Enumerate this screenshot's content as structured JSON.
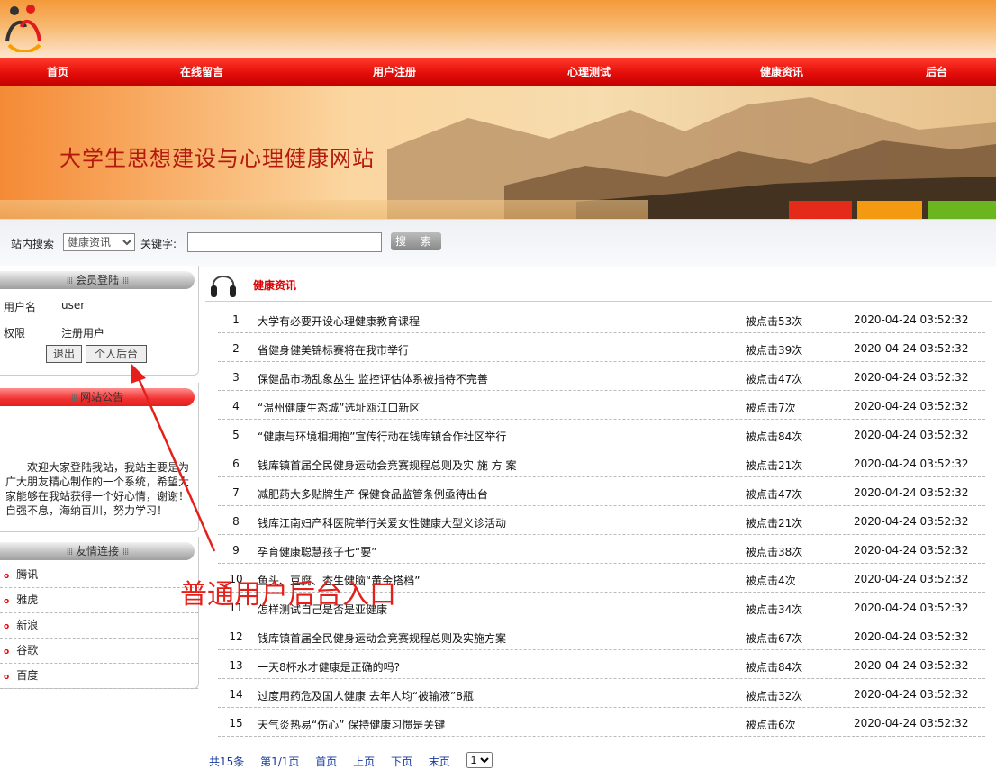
{
  "nav": [
    "首页",
    "在线留言",
    "用户注册",
    "心理测试",
    "健康资讯",
    "后台"
  ],
  "banner": {
    "title": "大学生思想建设与心理健康网站"
  },
  "search": {
    "site_label": "站内搜索",
    "selected": "健康资讯",
    "keyword_label": "关键字:",
    "keyword_value": "",
    "button": "搜 索"
  },
  "login": {
    "title": "会员登陆",
    "user_label": "用户名",
    "user_value": "user",
    "role_label": "权限",
    "role_value": "注册用户",
    "logout": "退出",
    "admin": "个人后台"
  },
  "notice": {
    "title": "网站公告",
    "text": "欢迎大家登陆我站，我站主要是为广大朋友精心制作的一个系统，希望大家能够在我站获得一个好心情，谢谢！ 自强不息，海纳百川，努力学习！"
  },
  "links": {
    "title": "友情连接",
    "items": [
      "腾讯",
      "雅虎",
      "新浪",
      "谷歌",
      "百度"
    ]
  },
  "main": {
    "category": "健康资讯",
    "articles": [
      {
        "n": "1",
        "title": "大学有必要开设心理健康教育课程",
        "clicks": "被点击53次",
        "date": "2020-04-24 03:52:32"
      },
      {
        "n": "2",
        "title": "省健身健美锦标赛将在我市举行",
        "clicks": "被点击39次",
        "date": "2020-04-24 03:52:32"
      },
      {
        "n": "3",
        "title": "保健品市场乱象丛生 监控评估体系被指待不完善",
        "clicks": "被点击47次",
        "date": "2020-04-24 03:52:32"
      },
      {
        "n": "4",
        "title": "“温州健康生态城”选址瓯江口新区",
        "clicks": "被点击7次",
        "date": "2020-04-24 03:52:32"
      },
      {
        "n": "5",
        "title": "“健康与环境相拥抱”宣传行动在钱库镇合作社区举行",
        "clicks": "被点击84次",
        "date": "2020-04-24 03:52:32"
      },
      {
        "n": "6",
        "title": "钱库镇首届全民健身运动会竞赛规程总则及实 施 方 案",
        "clicks": "被点击21次",
        "date": "2020-04-24 03:52:32"
      },
      {
        "n": "7",
        "title": "减肥药大多贴牌生产 保健食品监管条例亟待出台",
        "clicks": "被点击47次",
        "date": "2020-04-24 03:52:32"
      },
      {
        "n": "8",
        "title": "钱库江南妇产科医院举行关爱女性健康大型义诊活动",
        "clicks": "被点击21次",
        "date": "2020-04-24 03:52:32"
      },
      {
        "n": "9",
        "title": "孕育健康聪慧孩子七“要”",
        "clicks": "被点击38次",
        "date": "2020-04-24 03:52:32"
      },
      {
        "n": "10",
        "title": "鱼头、豆腐、杏生健脑“黄金搭档”",
        "clicks": "被点击4次",
        "date": "2020-04-24 03:52:32"
      },
      {
        "n": "11",
        "title": "怎样测试自己是否是亚健康",
        "clicks": "被点击34次",
        "date": "2020-04-24 03:52:32"
      },
      {
        "n": "12",
        "title": "钱库镇首届全民健身运动会竞赛规程总则及实施方案",
        "clicks": "被点击67次",
        "date": "2020-04-24 03:52:32"
      },
      {
        "n": "13",
        "title": "一天8杯水才健康是正确的吗?",
        "clicks": "被点击84次",
        "date": "2020-04-24 03:52:32"
      },
      {
        "n": "14",
        "title": "过度用药危及国人健康 去年人均“被输液”8瓶",
        "clicks": "被点击32次",
        "date": "2020-04-24 03:52:32"
      },
      {
        "n": "15",
        "title": "天气炎热易“伤心” 保持健康习惯是关键",
        "clicks": "被点击6次",
        "date": "2020-04-24 03:52:32"
      }
    ]
  },
  "pager": {
    "total": "共15条",
    "page": "第1/1页",
    "first": "首页",
    "prev": "上页",
    "next": "下页",
    "last": "末页",
    "select": "1"
  },
  "annotation": {
    "text": "普通用户后台入口",
    "color": "#e5201a"
  },
  "colors": {
    "nav_red": "#e30d0a",
    "title_red": "#b3190e",
    "link_blue": "#1a3c9e"
  }
}
